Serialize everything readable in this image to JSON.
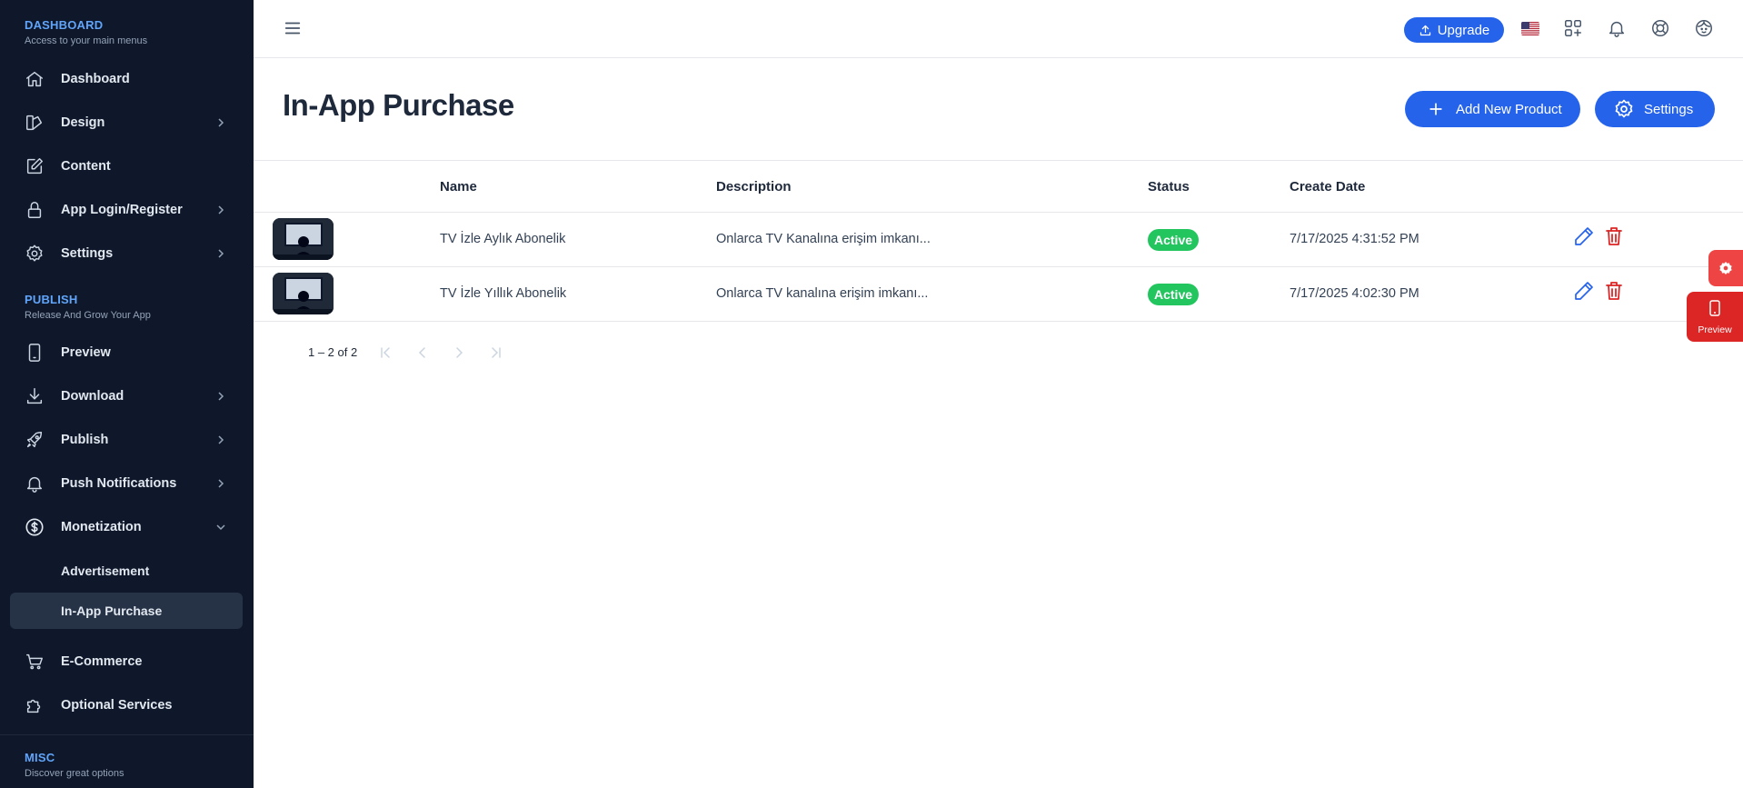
{
  "sidebar": {
    "sections": [
      {
        "title": "DASHBOARD",
        "subtitle": "Access to your main menus"
      },
      {
        "title": "PUBLISH",
        "subtitle": "Release And Grow Your App"
      },
      {
        "title": "MISC",
        "subtitle": "Discover great options"
      }
    ],
    "items": {
      "dashboard": "Dashboard",
      "design": "Design",
      "content": "Content",
      "app_login": "App Login/Register",
      "settings": "Settings",
      "preview": "Preview",
      "download": "Download",
      "publish": "Publish",
      "push": "Push Notifications",
      "monetization": "Monetization",
      "advertisement": "Advertisement",
      "in_app_purchase": "In-App Purchase",
      "ecommerce": "E-Commerce",
      "optional_services": "Optional Services"
    }
  },
  "topbar": {
    "upgrade_label": "Upgrade"
  },
  "page": {
    "title": "In-App Purchase",
    "add_button": "Add New Product",
    "settings_button": "Settings"
  },
  "table": {
    "columns": [
      "Name",
      "Description",
      "Status",
      "Create Date"
    ],
    "rows": [
      {
        "name": "TV İzle Aylık Abonelik",
        "description": "Onlarca TV Kanalına erişim imkanı...",
        "status": "Active",
        "date": "7/17/2025 4:31:52 PM"
      },
      {
        "name": "TV İzle Yıllık Abonelik",
        "description": "Onlarca TV kanalına erişim imkanı...",
        "status": "Active",
        "date": "7/17/2025 4:02:30 PM"
      }
    ]
  },
  "pagination": {
    "range": "1 – 2 of 2"
  },
  "floating": {
    "preview_label": "Preview"
  },
  "colors": {
    "accent": "#2563eb",
    "sidebar_bg": "#0f172a",
    "active_badge": "#22c55e",
    "danger": "#dc2626"
  }
}
